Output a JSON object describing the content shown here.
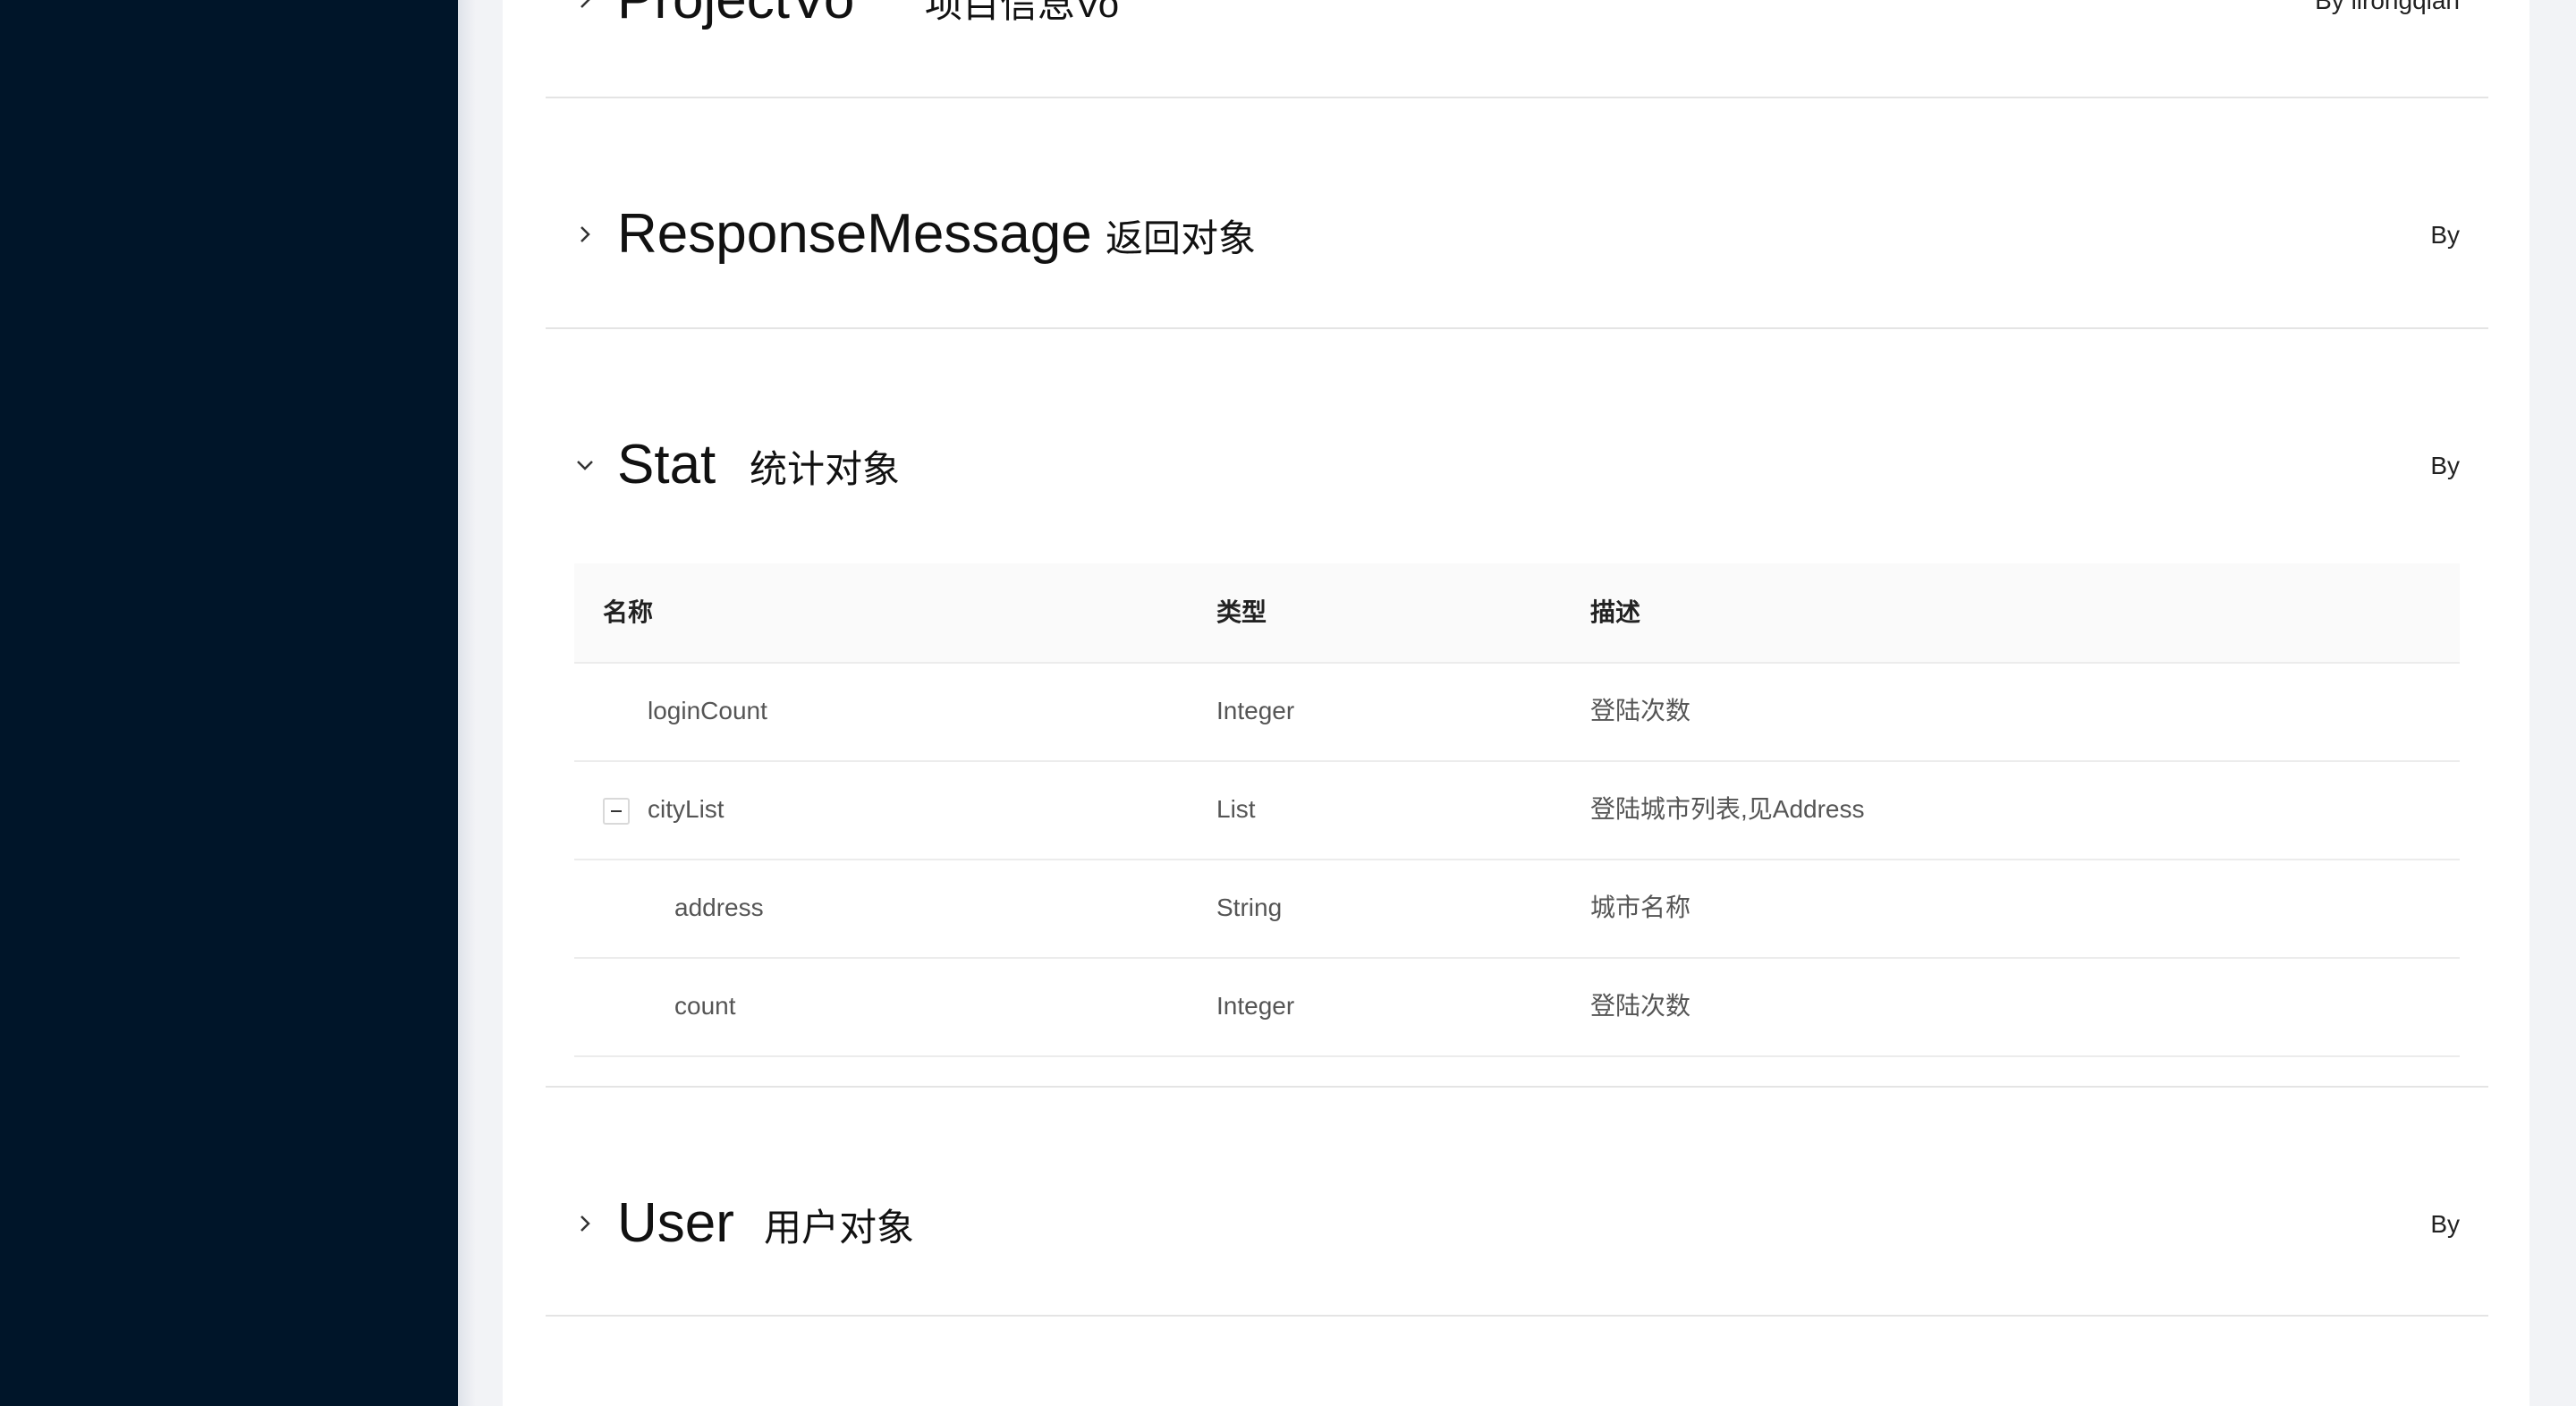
{
  "models": [
    {
      "name": "ProjectVo",
      "description": "项目信息Vo",
      "author": "By lirongqian",
      "expanded": false
    },
    {
      "name": "ResponseMessage",
      "description": "返回对象",
      "author": "By",
      "expanded": false
    },
    {
      "name": "Stat",
      "description": "统计对象",
      "author": "By",
      "expanded": true
    },
    {
      "name": "User",
      "description": "用户对象",
      "author": "By",
      "expanded": false
    }
  ],
  "table": {
    "headers": {
      "name": "名称",
      "type": "类型",
      "description": "描述"
    },
    "rows": [
      {
        "name": "loginCount",
        "type": "Integer",
        "description": "登陆次数"
      },
      {
        "name": "cityList",
        "type": "List",
        "description": "登陆城市列表,见Address"
      },
      {
        "name": "address",
        "type": "String",
        "description": "城市名称"
      },
      {
        "name": "count",
        "type": "Integer",
        "description": "登陆次数"
      }
    ]
  },
  "colors": {
    "sidebar": "#001529",
    "content_background": "#ffffff",
    "page_background": "#f0f2f5",
    "table_header": "#fafafa"
  }
}
